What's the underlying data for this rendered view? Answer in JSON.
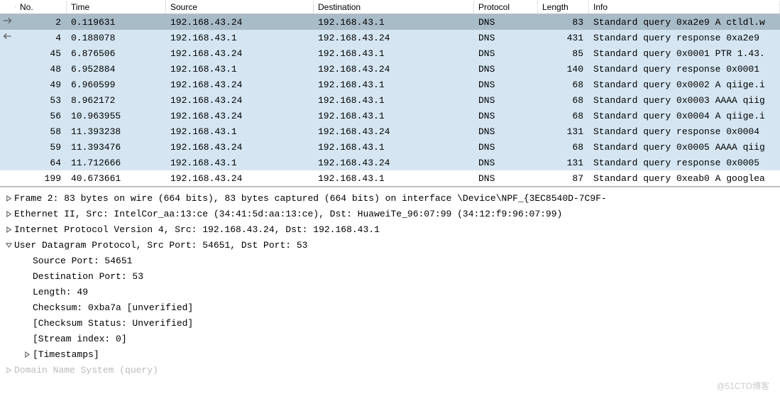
{
  "columns": {
    "no": "No.",
    "time": "Time",
    "source": "Source",
    "destination": "Destination",
    "protocol": "Protocol",
    "length": "Length",
    "info": "Info"
  },
  "packets": [
    {
      "no": "2",
      "time": "0.119631",
      "source": "192.168.43.24",
      "dest": "192.168.43.1",
      "protocol": "DNS",
      "length": "83",
      "info": "Standard query 0xa2e9 A ctldl.w",
      "state": "selected",
      "arrow": "out"
    },
    {
      "no": "4",
      "time": "0.188078",
      "source": "192.168.43.1",
      "dest": "192.168.43.24",
      "protocol": "DNS",
      "length": "431",
      "info": "Standard query response 0xa2e9 ",
      "state": "highlighted",
      "arrow": "in"
    },
    {
      "no": "45",
      "time": "6.876506",
      "source": "192.168.43.24",
      "dest": "192.168.43.1",
      "protocol": "DNS",
      "length": "85",
      "info": "Standard query 0x0001 PTR 1.43.",
      "state": "highlighted"
    },
    {
      "no": "48",
      "time": "6.952884",
      "source": "192.168.43.1",
      "dest": "192.168.43.24",
      "protocol": "DNS",
      "length": "140",
      "info": "Standard query response 0x0001 ",
      "state": "highlighted"
    },
    {
      "no": "49",
      "time": "6.960599",
      "source": "192.168.43.24",
      "dest": "192.168.43.1",
      "protocol": "DNS",
      "length": "68",
      "info": "Standard query 0x0002 A qiige.i",
      "state": "highlighted"
    },
    {
      "no": "53",
      "time": "8.962172",
      "source": "192.168.43.24",
      "dest": "192.168.43.1",
      "protocol": "DNS",
      "length": "68",
      "info": "Standard query 0x0003 AAAA qiig",
      "state": "highlighted"
    },
    {
      "no": "56",
      "time": "10.963955",
      "source": "192.168.43.24",
      "dest": "192.168.43.1",
      "protocol": "DNS",
      "length": "68",
      "info": "Standard query 0x0004 A qiige.i",
      "state": "highlighted"
    },
    {
      "no": "58",
      "time": "11.393238",
      "source": "192.168.43.1",
      "dest": "192.168.43.24",
      "protocol": "DNS",
      "length": "131",
      "info": "Standard query response 0x0004 ",
      "state": "highlighted"
    },
    {
      "no": "59",
      "time": "11.393476",
      "source": "192.168.43.24",
      "dest": "192.168.43.1",
      "protocol": "DNS",
      "length": "68",
      "info": "Standard query 0x0005 AAAA qiig",
      "state": "highlighted"
    },
    {
      "no": "64",
      "time": "11.712666",
      "source": "192.168.43.1",
      "dest": "192.168.43.24",
      "protocol": "DNS",
      "length": "131",
      "info": "Standard query response 0x0005 ",
      "state": "highlighted"
    },
    {
      "no": "199",
      "time": "40.673661",
      "source": "192.168.43.24",
      "dest": "192.168.43.1",
      "protocol": "DNS",
      "length": "87",
      "info": "Standard query 0xeab0 A googlea",
      "state": "normal"
    }
  ],
  "details": {
    "frame": "Frame 2: 83 bytes on wire (664 bits), 83 bytes captured (664 bits) on interface \\Device\\NPF_{3EC8540D-7C9F-",
    "eth": "Ethernet II, Src: IntelCor_aa:13:ce (34:41:5d:aa:13:ce), Dst: HuaweiTe_96:07:99 (34:12:f9:96:07:99)",
    "ip": "Internet Protocol Version 4, Src: 192.168.43.24, Dst: 192.168.43.1",
    "udp": "User Datagram Protocol, Src Port: 54651, Dst Port: 53",
    "udp_children": {
      "src_port": "Source Port: 54651",
      "dst_port": "Destination Port: 53",
      "length": "Length: 49",
      "checksum": "Checksum: 0xba7a [unverified]",
      "checksum_status": "[Checksum Status: Unverified]",
      "stream_index": "[Stream index: 0]",
      "timestamps": "[Timestamps]"
    },
    "dns": "Domain Name System (query)"
  },
  "watermark": "@51CTO博客"
}
